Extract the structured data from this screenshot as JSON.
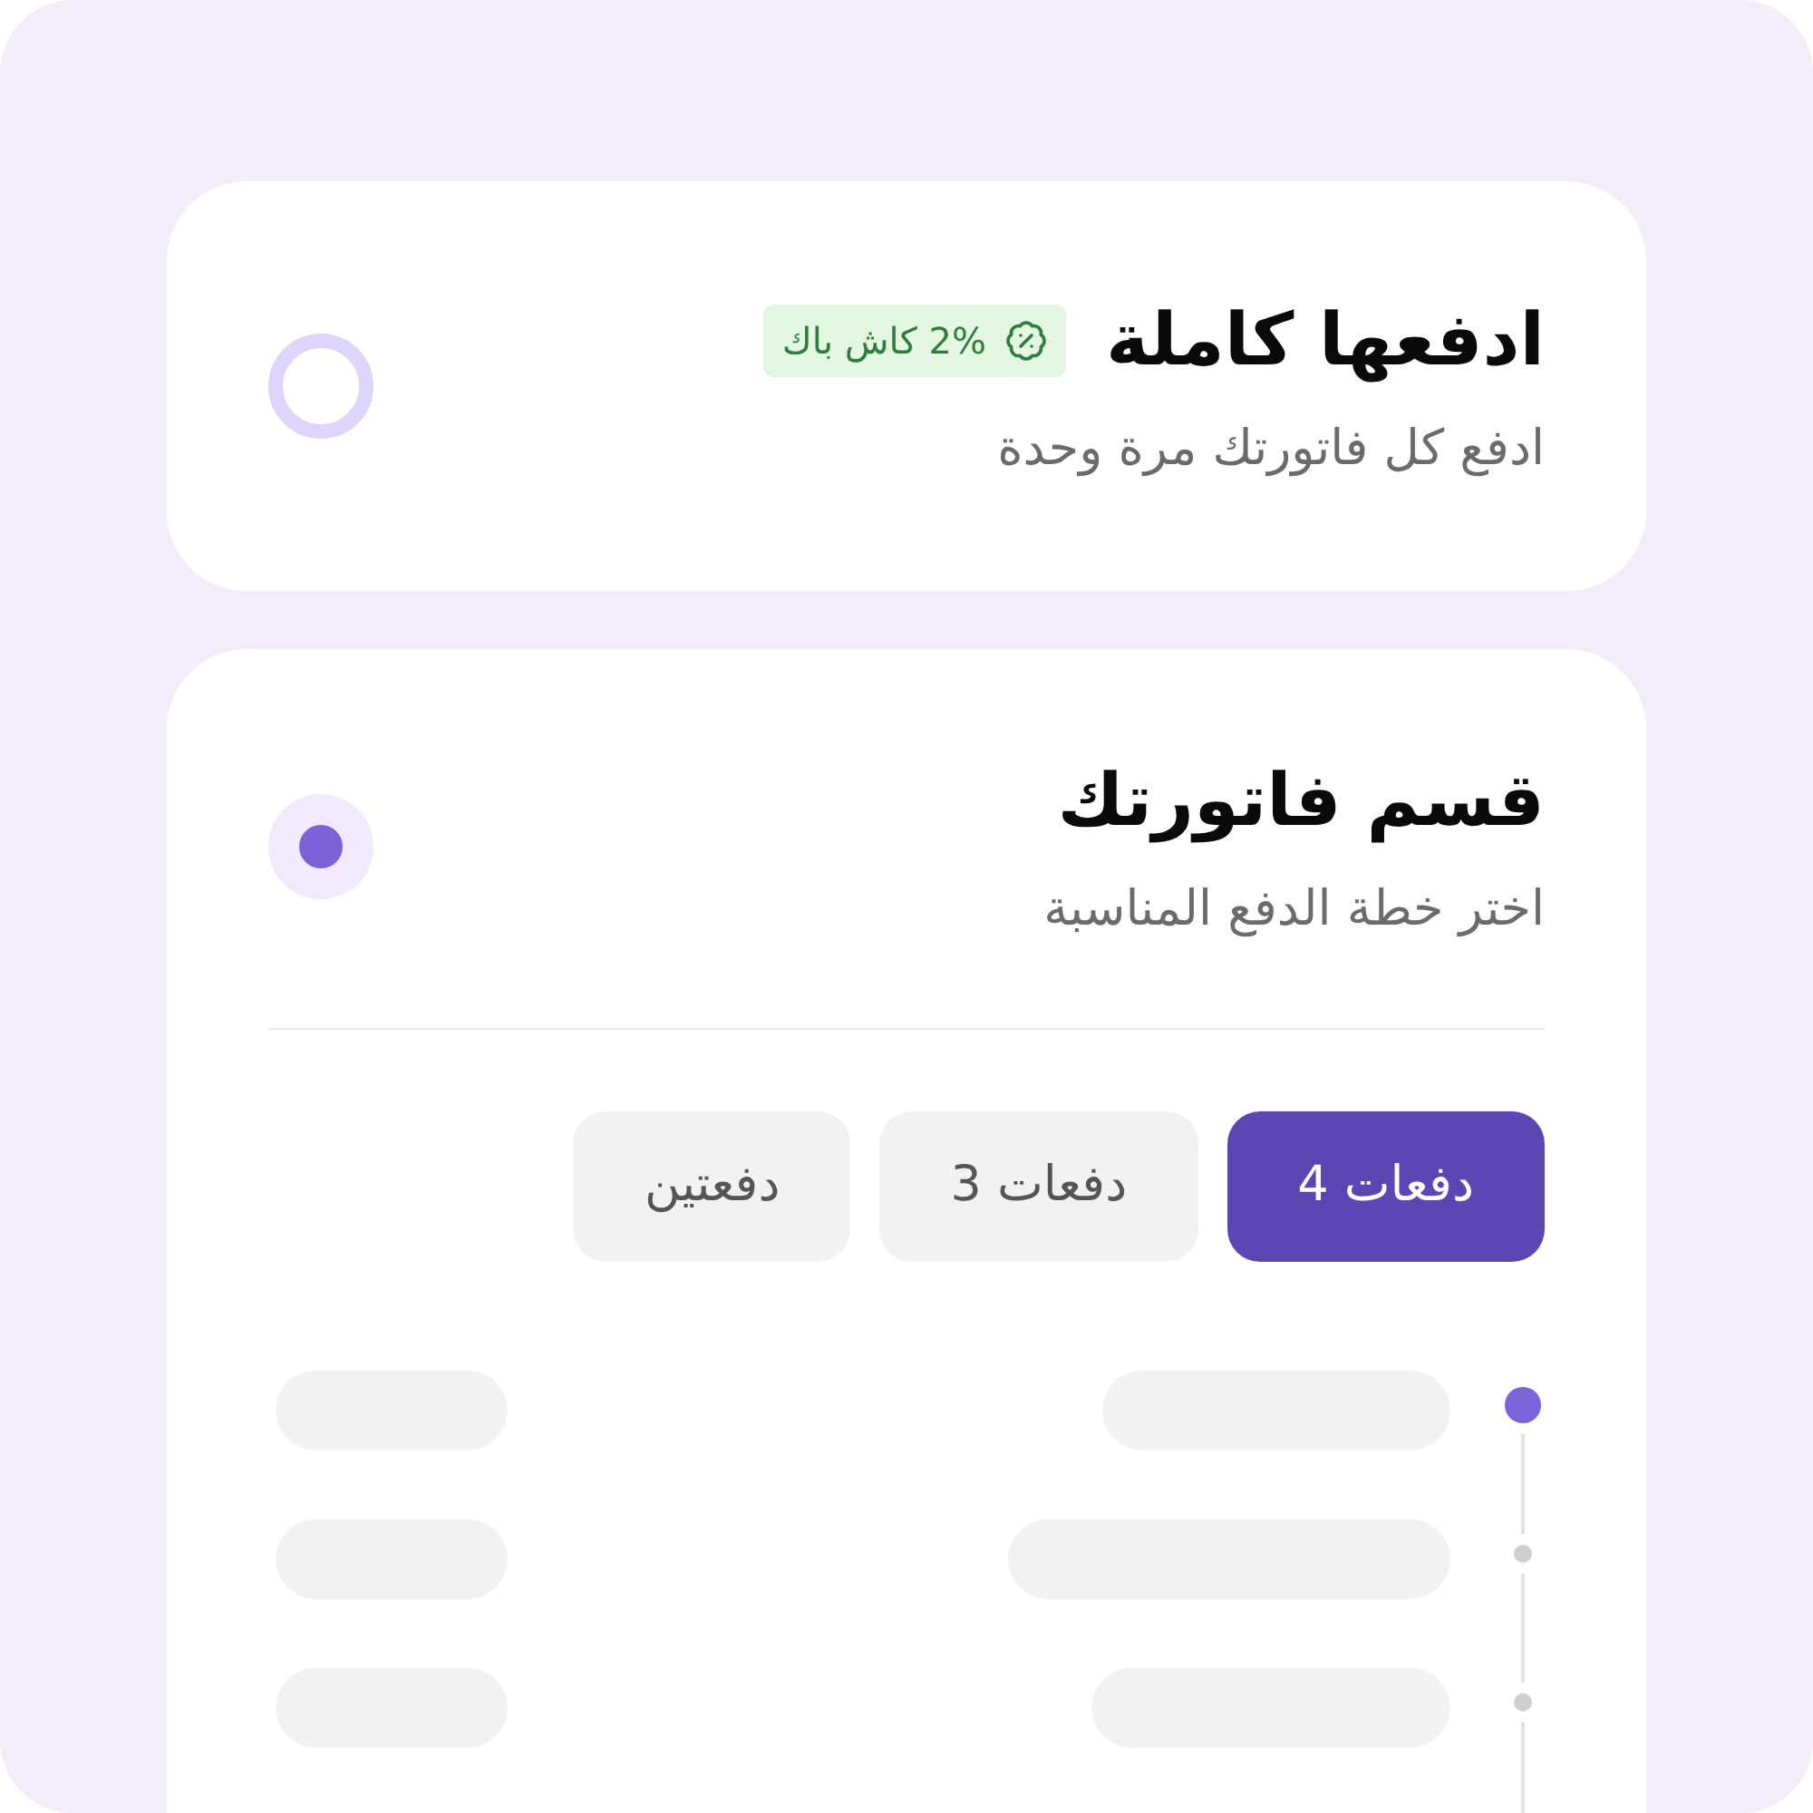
{
  "options": [
    {
      "title": "ادفعها كاملة",
      "badge": {
        "text": "2% كاش باك"
      },
      "subtitle": "ادفع كل فاتورتك مرة وحدة",
      "selected": false
    },
    {
      "title": "قسم فاتورتك",
      "subtitle": "اختر خطة الدفع المناسبة",
      "selected": true,
      "tabs": [
        {
          "label": "4 دفعات",
          "selected": true
        },
        {
          "label": "3 دفعات",
          "selected": false
        },
        {
          "label": "دفعتين",
          "selected": false
        }
      ],
      "schedule": [
        {
          "current": true
        },
        {
          "current": false
        },
        {
          "current": false
        }
      ]
    }
  ]
}
